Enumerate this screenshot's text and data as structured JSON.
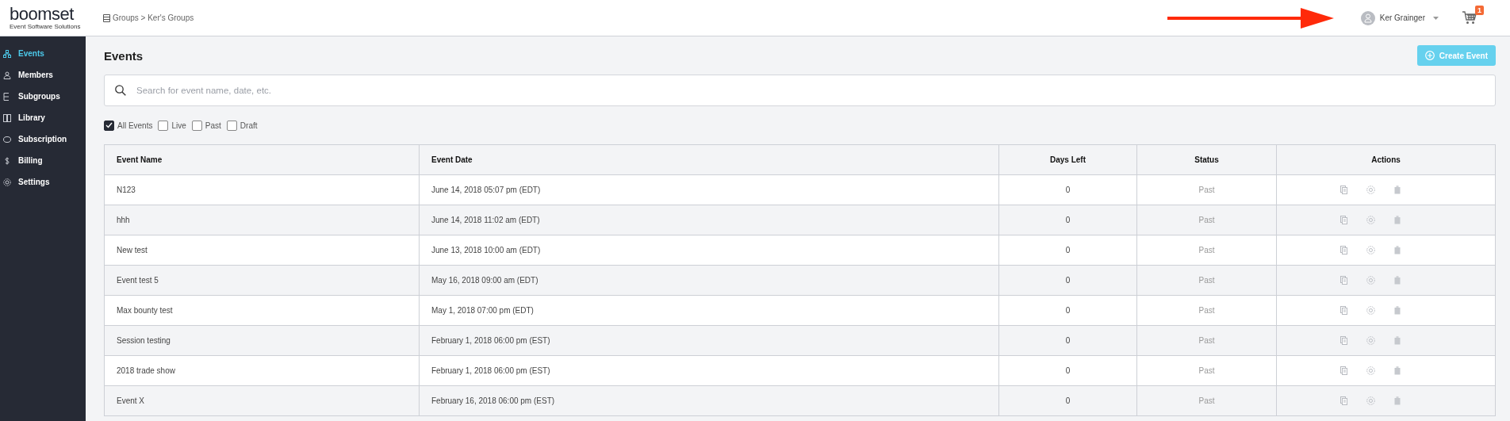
{
  "header": {
    "logo": "boomset",
    "tagline": "Event Software Solutions",
    "breadcrumb": "Groups > Ker's Groups",
    "user": "Ker Grainger",
    "cart_badge": "1"
  },
  "sidebar": {
    "items": [
      {
        "label": "Events",
        "kind": "events",
        "selected": true
      },
      {
        "label": "Members",
        "kind": "members",
        "selected": false
      },
      {
        "label": "Subgroups",
        "kind": "subgroups",
        "selected": false
      },
      {
        "label": "Library",
        "kind": "library",
        "selected": false
      },
      {
        "label": "Subscription",
        "kind": "subscription",
        "selected": false
      },
      {
        "label": "Billing",
        "kind": "billing",
        "selected": false
      },
      {
        "label": "Settings",
        "kind": "settings",
        "selected": false
      }
    ]
  },
  "page": {
    "title": "Events",
    "create_button": "Create Event",
    "search": {
      "placeholder": "Search for event name, date, etc."
    },
    "filters": [
      {
        "label": "All Events",
        "checked": true
      },
      {
        "label": "Live",
        "checked": false
      },
      {
        "label": "Past",
        "checked": false
      },
      {
        "label": "Draft",
        "checked": false
      }
    ]
  },
  "table": {
    "columns": [
      "Event Name",
      "Event Date",
      "Days Left",
      "Status",
      "Actions"
    ],
    "rows": [
      {
        "name": "N123",
        "date": "June 14, 2018 05:07 pm (EDT)",
        "days_left": "0",
        "status": "Past"
      },
      {
        "name": "hhh",
        "date": "June 14, 2018 11:02 am (EDT)",
        "days_left": "0",
        "status": "Past"
      },
      {
        "name": "New test",
        "date": "June 13, 2018 10:00 am (EDT)",
        "days_left": "0",
        "status": "Past"
      },
      {
        "name": "Event test 5",
        "date": "May 16, 2018 09:00 am (EDT)",
        "days_left": "0",
        "status": "Past"
      },
      {
        "name": "Max bounty test",
        "date": "May 1, 2018 07:00 pm (EDT)",
        "days_left": "0",
        "status": "Past"
      },
      {
        "name": "Session testing",
        "date": "February 1, 2018 06:00 pm (EST)",
        "days_left": "0",
        "status": "Past"
      },
      {
        "name": "2018 trade show",
        "date": "February 1, 2018 06:00 pm (EST)",
        "days_left": "0",
        "status": "Past"
      },
      {
        "name": "Event X",
        "date": "February 16, 2018 06:00 pm (EST)",
        "days_left": "0",
        "status": "Past"
      }
    ]
  }
}
